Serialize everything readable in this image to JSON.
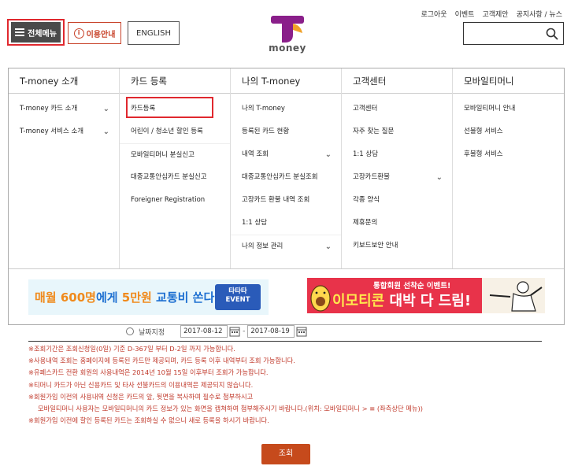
{
  "header": {
    "all_menu_label": "전체메뉴",
    "guide_label": "이용안내",
    "guide_icon_glyph": "i",
    "english_label": "ENGLISH",
    "logo_text": "money",
    "top_links": [
      "로그아웃",
      "이벤트",
      "고객제안",
      "공지사항 / 뉴스"
    ],
    "search_placeholder": "",
    "accent_color": "#e0282e",
    "logo_colors": [
      "#8a1f8a",
      "#f0a22a"
    ]
  },
  "menu": {
    "columns": [
      {
        "title": "T-money 소개",
        "items": [
          {
            "label": "T-money 카드 소개",
            "chevron": true
          },
          {
            "label": "T-money 서비스 소개",
            "chevron": true
          }
        ]
      },
      {
        "title": "카드 등록",
        "items": [
          {
            "label": "카드등록",
            "chevron": false
          },
          {
            "label": "어린이 / 청소년 할인 등록",
            "chevron": false
          },
          {
            "label": "모바일티머니 분실신고",
            "chevron": false
          },
          {
            "label": "대중교통안심카드 분실신고",
            "chevron": false
          },
          {
            "label": "Foreigner Registration",
            "chevron": false
          }
        ]
      },
      {
        "title": "나의 T-money",
        "items": [
          {
            "label": "나의 T-money",
            "chevron": false
          },
          {
            "label": "등록된 카드 현황",
            "chevron": false
          },
          {
            "label": "내역 조회",
            "chevron": true
          },
          {
            "label": "대중교통안심카드 분실조회",
            "chevron": false
          },
          {
            "label": "고장카드 환불 내역 조회",
            "chevron": false
          },
          {
            "label": "1:1 상담",
            "chevron": false
          },
          {
            "label": "나의 정보 관리",
            "chevron": true
          }
        ]
      },
      {
        "title": "고객센터",
        "items": [
          {
            "label": "고객센터",
            "chevron": false
          },
          {
            "label": "자주 찾는 질문",
            "chevron": false
          },
          {
            "label": "1:1 상담",
            "chevron": false
          },
          {
            "label": "고장카드환불",
            "chevron": true
          },
          {
            "label": "각종 양식",
            "chevron": false
          },
          {
            "label": "제휴문의",
            "chevron": false
          },
          {
            "label": "키보드보안 안내",
            "chevron": false
          }
        ]
      },
      {
        "title": "모바일티머니",
        "items": [
          {
            "label": "모바일티머니 안내",
            "chevron": false
          },
          {
            "label": "선불형 서비스",
            "chevron": false
          },
          {
            "label": "후불형 서비스",
            "chevron": false
          }
        ]
      }
    ]
  },
  "banners": {
    "b1_part1": "매월 600명",
    "b1_part2": "에게 ",
    "b1_part3": "5만원",
    "b1_part4": " 교통비 쏜다!",
    "b1_event_line1": "타타타",
    "b1_event_line2": "EVENT",
    "b2_small": "통합회원 선착순 이벤트!",
    "b2_part1": "이모티콘",
    "b2_part2": " 대박 다 드림!"
  },
  "search_form": {
    "radio_label": "날짜지정",
    "date_from": "2017-08-12",
    "date_to": "2017-08-19",
    "dash": "-"
  },
  "notes": [
    "※조회기간은 조회신청일(0일) 기준 D-367일 부터 D-2일 까지 가능합니다.",
    "※사용내역 조회는 홈페이지에 등록된 카드만 제공되며, 카드 등록 이후 내역부터 조회 가능합니다.",
    "※유페스카드 전환 회원의 사용내역은 2014년 10월 15일 이후부터 조회가 가능합니다.",
    "※티머니 카드가 아닌 신용카드 및 타사 선불카드의 이용내역은 제공되지 않습니다.",
    "※회원가입 이전의 사용내역 신청은 카드의 앞, 뒷면을 복사하여 필수로 첨부하시고",
    "모바일티머니 사용자는 모바일티머니의 카드 정보가 있는 화면을 캡쳐하여 첨부해주시기 바랍니다.(위치: 모바일티머니 > ≡ (좌측상단 메뉴))",
    "※회원가입 이전에 할인 등록된 카드는 조회하실 수 없으니 새로 등록을 하시기 바랍니다."
  ],
  "submit_label": "조회"
}
